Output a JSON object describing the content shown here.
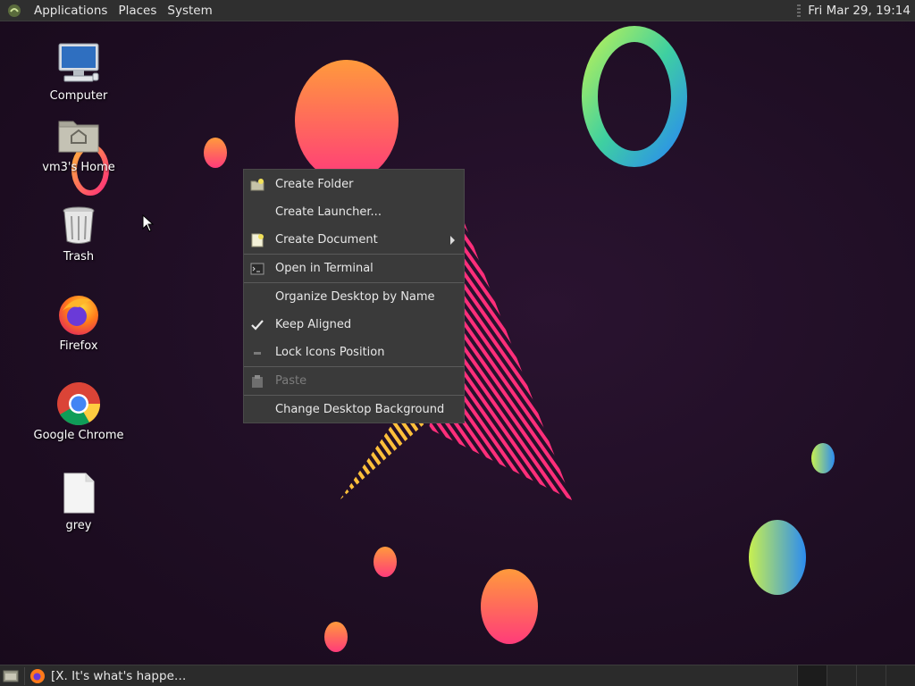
{
  "top_panel": {
    "menus": [
      "Applications",
      "Places",
      "System"
    ],
    "clock": "Fri Mar 29, 19:14"
  },
  "desktop_icons": [
    {
      "label": "Computer",
      "icon": "computer-icon"
    },
    {
      "label": "vm3's Home",
      "icon": "home-folder-icon"
    },
    {
      "label": "Trash",
      "icon": "trash-icon"
    },
    {
      "label": "Firefox",
      "icon": "firefox-icon"
    },
    {
      "label": "Google Chrome",
      "icon": "chrome-icon"
    },
    {
      "label": "grey",
      "icon": "file-icon"
    }
  ],
  "context_menu": {
    "items": [
      {
        "label": "Create Folder",
        "icon": "folder-new-icon"
      },
      {
        "label": "Create Launcher...",
        "icon": ""
      },
      {
        "label": "Create Document",
        "icon": "document-new-icon",
        "submenu": true
      },
      {
        "label": "Open in Terminal",
        "icon": "terminal-icon"
      },
      {
        "label": "Organize Desktop by Name",
        "icon": ""
      },
      {
        "label": "Keep Aligned",
        "icon": "check-icon",
        "checked": true
      },
      {
        "label": "Lock Icons Position",
        "icon": "dash-icon"
      },
      {
        "label": "Paste",
        "icon": "clipboard-icon",
        "disabled": true
      },
      {
        "label": "Change Desktop Background",
        "icon": ""
      }
    ]
  },
  "bottom_panel": {
    "task_title": "[X. It's what's happe…",
    "task_icon": "firefox-icon"
  },
  "colors": {
    "panel_bg": "#2f2f2f",
    "menu_bg": "#3a3a3a",
    "wallpaper_bg": "#1e0f22"
  }
}
